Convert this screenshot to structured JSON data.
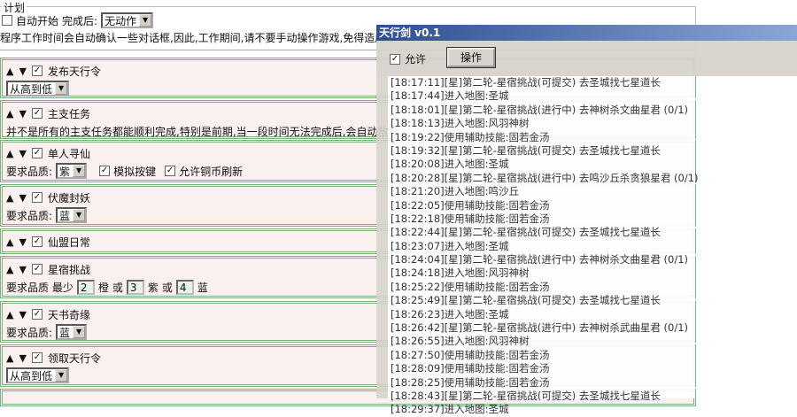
{
  "plan": {
    "legend": "计划",
    "auto_start": "自动开始",
    "after_label": "完成后:",
    "after_value": "无动作",
    "note": "程序工作时间会自动确认一些对话框,因此,工作期间,请不要手动操作游戏,免得造成意"
  },
  "sections": [
    {
      "title": "发布天行令",
      "select": "从高到低"
    },
    {
      "title": "主支任务",
      "note": "并不是所有的主支任务都能顺利完成,特别是前期,当一段时间无法完成后,会自动放弃"
    },
    {
      "title": "单人寻仙",
      "quality_label": "要求品质:",
      "quality": "紫",
      "opt1": "模拟按键",
      "opt2": "允许铜币刷新"
    },
    {
      "title": "伏魔封妖",
      "quality_label": "要求品质:",
      "quality": "蓝"
    },
    {
      "title": "仙盟日常"
    },
    {
      "title": "星宿挑战",
      "label": "要求品质 最少",
      "v1": "2",
      "c1": "橙",
      "or": "或",
      "v2": "3",
      "c2": "紫",
      "v3": "4",
      "c3": "蓝"
    },
    {
      "title": "天书奇缘",
      "quality_label": "要求品质:",
      "quality": "蓝"
    },
    {
      "title": "领取天行令",
      "select": "从高到低"
    }
  ],
  "window": {
    "title": "天行剑 v0.1",
    "allow": "允许",
    "op_button": "操作",
    "log": [
      "[18:17:11][星]第二轮-星宿挑战(可提交) 去圣城找七星道长",
      "[18:17:44]进入地图:圣城",
      "[18:18:01][星]第二轮-星宿挑战(进行中) 去神树杀文曲星君   (0/1)",
      "[18:18:13]进入地图:风羽神树",
      "[18:19:22]使用辅助技能:固若金汤",
      "[18:19:32][星]第二轮-星宿挑战(可提交) 去圣城找七星道长",
      "[18:20:08]进入地图:圣城",
      "[18:20:28][星]第二轮-星宿挑战(进行中) 去鸣沙丘杀贪狼星君   (0/1)",
      "[18:21:20]进入地图:鸣沙丘",
      "[18:22:05]使用辅助技能:固若金汤",
      "[18:22:18]使用辅助技能:固若金汤",
      "[18:22:44][星]第二轮-星宿挑战(可提交) 去圣城找七星道长",
      "[18:23:07]进入地图:圣城",
      "[18:24:04][星]第二轮-星宿挑战(进行中) 去神树杀文曲星君   (0/1)",
      "[18:24:18]进入地图:风羽神树",
      "[18:25:22]使用辅助技能:固若金汤",
      "[18:25:49][星]第二轮-星宿挑战(可提交) 去圣城找七星道长",
      "[18:26:23]进入地图:圣城",
      "[18:26:42][星]第二轮-星宿挑战(进行中) 去神树杀武曲星君   (0/1)",
      "[18:26:55]进入地图:风羽神树",
      "[18:27:50]使用辅助技能:固若金汤",
      "[18:28:09]使用辅助技能:固若金汤",
      "[18:28:25]使用辅助技能:固若金汤",
      "[18:28:43][星]第二轮-星宿挑战(可提交) 去圣城找七星道长",
      "[18:29:37]进入地图:圣城"
    ]
  }
}
